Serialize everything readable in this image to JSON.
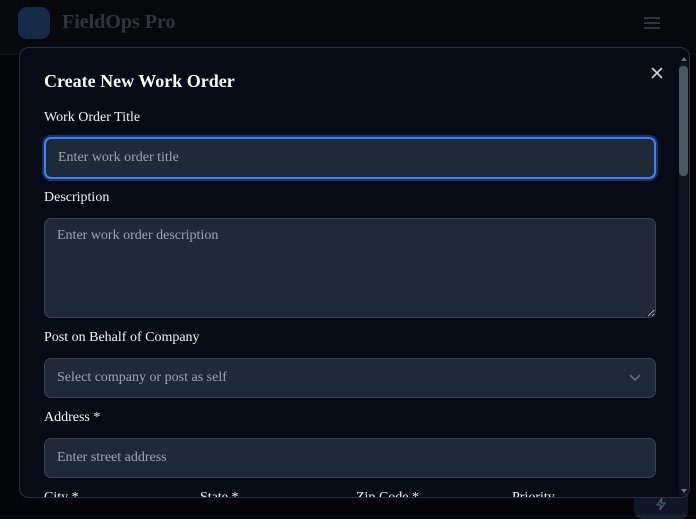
{
  "app": {
    "title": "FieldOps Pro"
  },
  "modal": {
    "title": "Create New Work Order",
    "fields": {
      "title": {
        "label": "Work Order Title",
        "placeholder": "Enter work order title"
      },
      "description": {
        "label": "Description",
        "placeholder": "Enter work order description"
      },
      "company": {
        "label": "Post on Behalf of Company",
        "selected": "Select company or post as self"
      },
      "address": {
        "label": "Address *",
        "placeholder": "Enter street address"
      }
    },
    "row_labels": [
      "City *",
      "State *",
      "Zip Code *",
      "Priority"
    ]
  },
  "icons": {
    "menu": "hamburger-menu-icon",
    "close": "close-icon",
    "chevron": "chevron-down-icon",
    "fab": "lightning-icon"
  },
  "colors": {
    "accent": "#3b82f6",
    "background": "#05070d",
    "field": "#1f2937"
  }
}
